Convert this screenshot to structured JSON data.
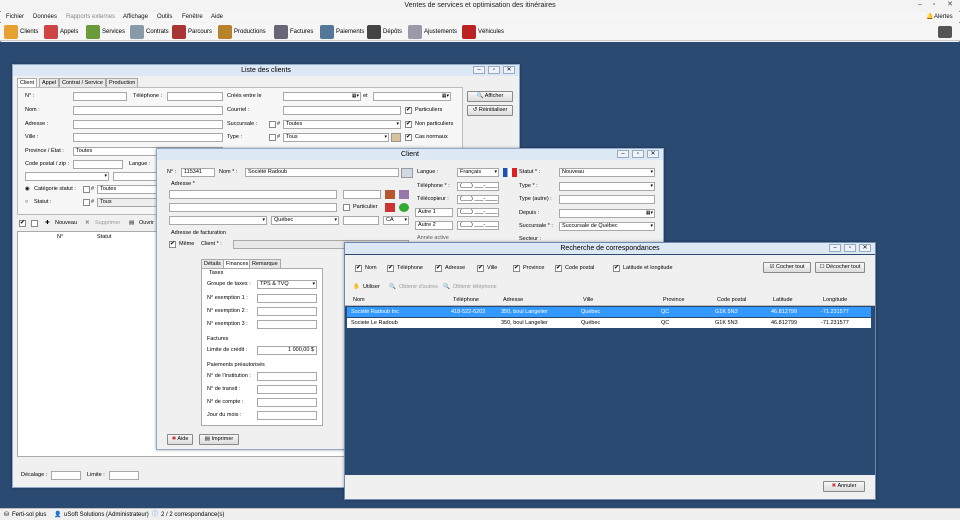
{
  "app": {
    "title": "Ventes de services et optimisation des itinéraires",
    "alerts_label": "Alertes",
    "menu": [
      "Fichier",
      "Données",
      "Rapports externes",
      "Affichage",
      "Outils",
      "Fenêtre",
      "Aide"
    ],
    "toolbar": [
      "Clients",
      "Appels",
      "Services",
      "Contrats",
      "Parcours",
      "Productions",
      "Factures",
      "Paiements",
      "Dépôts",
      "Ajustements",
      "Véhicules"
    ]
  },
  "liste": {
    "title": "Liste des clients",
    "tabs": [
      "Client",
      "Appel",
      "Contrat / Service",
      "Production"
    ],
    "labels": {
      "no": "N° :",
      "telephone": "Téléphone :",
      "nom": "Nom :",
      "adresse": "Adresse :",
      "ville": "Ville :",
      "province": "Province / État :",
      "code_postal": "Code postal / zip :",
      "langue": "Langue :",
      "creees": "Créés entre le",
      "et": "et",
      "courriel": "Courriel :",
      "succursale": "Succursale :",
      "type": "Type :",
      "categorie": "Catégorie statut :",
      "statut": "Statut :",
      "hash": "#"
    },
    "province_value": "Toutes",
    "succursale_value": "Toutes",
    "type_value": "Tous",
    "categorie_value": "Toutes",
    "statut_value": "Tous",
    "checks": [
      "Particuliers",
      "Non particuliers",
      "Cas normaux"
    ],
    "afficher": "Afficher",
    "reinitialiser": "Réinitialiser",
    "actions": [
      "Nouveau",
      "Supprimer",
      "Ouvrir"
    ],
    "columns": [
      "N°",
      "Statut"
    ],
    "decalage": "Décalage :",
    "limite": "Limite :"
  },
  "client": {
    "title": "Client",
    "no_label": "N° :",
    "no_value": "115341",
    "nom_label": "Nom * :",
    "nom_value": "Société Radoub",
    "adresse_label": "Adresse *",
    "particulier": "Particulier",
    "province_value": "Québec",
    "country_value": "CA",
    "facturation_label": "Adresse de facturation",
    "meme": "Même",
    "client_label": "Client * :",
    "langue_label": "Langue :",
    "langue_value": "Français",
    "statut_label": "Statut * :",
    "statut_value": "Nouveau",
    "telephone_label": "Téléphone * :",
    "type_label": "Type * :",
    "telecopieur_label": "Télécopieur :",
    "type_autre_label": "Type (autre) :",
    "autre1": "Autre 1",
    "autre2": "Autre 2",
    "depuis_label": "Depuis :",
    "succursale_label": "Succursale * :",
    "succursale_value": "Succursale de Québec",
    "secteur_label": "Secteur :",
    "annee_label": "Année active",
    "phone_mask": "(___) ___-____",
    "tabs": [
      "Détails",
      "Finances",
      "Remarque"
    ],
    "taxes_title": "Taxes",
    "groupe_taxes_label": "Groupe de taxes :",
    "groupe_taxes_value": "TPS & TVQ",
    "exemptions": [
      "N° exemption 1 :",
      "N° exemption 2 :",
      "N° exemption 3 :"
    ],
    "factures_title": "Factures",
    "limite_credit_label": "Limite de crédit :",
    "limite_credit_value": "1 000,00 $",
    "paiements_title": "Paiements préautorisés",
    "paiements_fields": [
      "N° de l'institution :",
      "N° de transit :",
      "N° de compte :",
      "Jour du mois :"
    ],
    "aide": "Aide",
    "imprimer": "Imprimer"
  },
  "recherche": {
    "title": "Recherche de correspondances",
    "checks": [
      "Nom",
      "Téléphone",
      "Adresse",
      "Ville",
      "Province",
      "Code postal",
      "Latitude et longitude"
    ],
    "cocher_tout": "Cocher tout",
    "decocher_tout": "Décocher tout",
    "actions": [
      "Utiliser",
      "Obtenir d'autres",
      "Obtenir téléphone"
    ],
    "columns": [
      "Nom",
      "Téléphone",
      "Adresse",
      "Ville",
      "Province",
      "Code postal",
      "Latitude",
      "Longitude"
    ],
    "rows": [
      [
        "Société Radoub Inc",
        "418-522-6202",
        "350, boul Langelier",
        "Québec",
        "QC",
        "G1K 5N3",
        "46.812799",
        "-71.231577"
      ],
      [
        "Societe Le Radoub",
        "",
        "350, boul Langelier",
        "Québec",
        "QC",
        "G1K 5N3",
        "46.812799",
        "-71.231577"
      ]
    ],
    "annuler": "Annuler"
  },
  "status": {
    "db": "Ferti-sol plus",
    "user": "uSoft Solutions (Administrateur)",
    "matches": "2 / 2 correspondance(s)"
  },
  "colors": {
    "mdi_bg": "#2b4a72",
    "selection": "#3399ff",
    "dialog_bg": "#2b4a72"
  }
}
